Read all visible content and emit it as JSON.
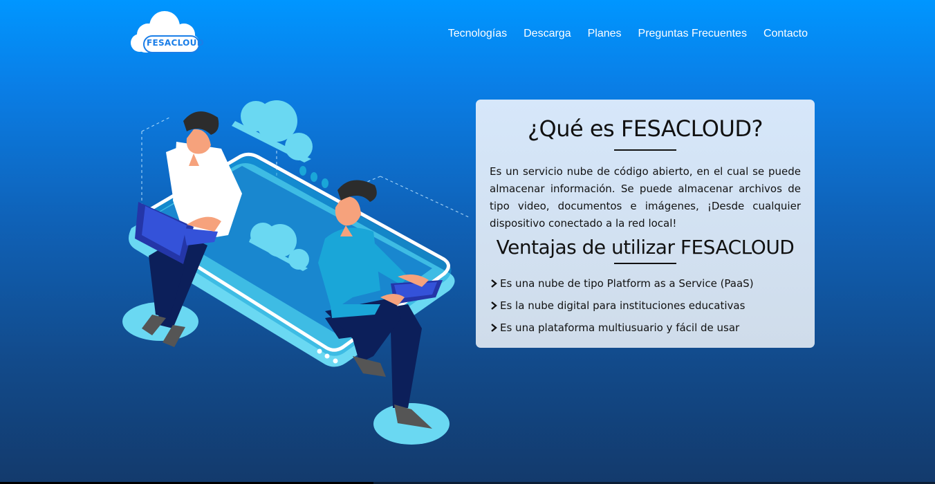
{
  "header": {
    "logo_text": "FESACLOUD",
    "nav": [
      {
        "label": "Tecnologías"
      },
      {
        "label": "Descarga"
      },
      {
        "label": "Planes"
      },
      {
        "label": "Preguntas Frecuentes"
      },
      {
        "label": "Contacto"
      }
    ]
  },
  "card": {
    "title": "¿Qué es FESACLOUD?",
    "description": "Es un servicio nube de código abierto, en el cual se puede almacenar información. Se puede almacenar archivos de tipo video, documentos e imágenes, ¡Desde cualquier dispositivo conectado a la red local!",
    "advantages_title": "Ventajas de utilizar FESACLOUD",
    "advantages": [
      "Es una nube de tipo Platform as a Service (PaaS)",
      "Es la nube digital para instituciones educativas",
      "Es una plataforma multiusuario y fácil de usar"
    ]
  },
  "colors": {
    "background_top": "#0096ff",
    "background_bottom": "#133a6c",
    "card_background": "#d6e7fa",
    "nav_text": "#ffffff",
    "logo_text": "#1a7ee8",
    "illustration_light": "#6ad8f2",
    "shirt_blue": "#1aa6d8",
    "pants_navy": "#0c1f5a"
  },
  "icons": {
    "logo": "cloud-logo-icon",
    "bullet": "chevron-right-icon"
  }
}
